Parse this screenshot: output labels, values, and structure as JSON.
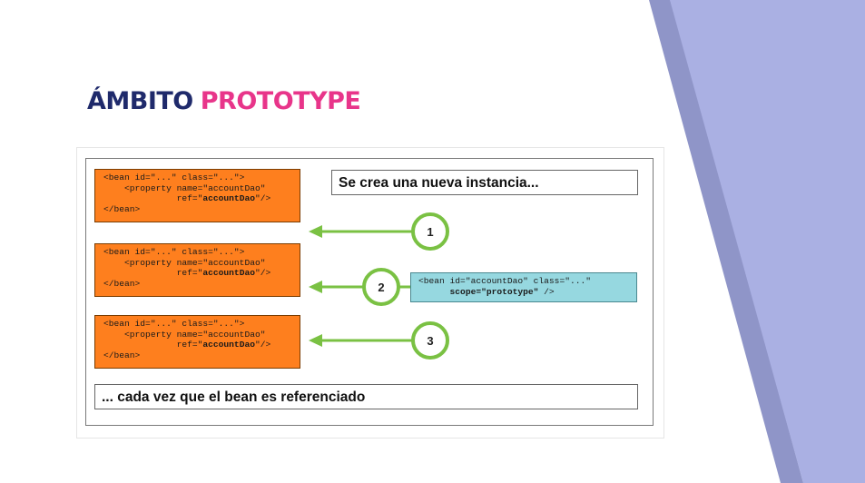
{
  "colors": {
    "title_primary": "#1f2a6b",
    "title_accent": "#e8358a",
    "bean_fill": "#fe7f1e",
    "prototype_fill": "#96d8e0",
    "arrow": "#7ac143",
    "side_band": "#aab0e3"
  },
  "title": {
    "word1": "ÁMBITO",
    "word2": "PROTOTYPE"
  },
  "diagram": {
    "top_caption": "Se crea una nueva instancia...",
    "bottom_caption": "... cada vez que el bean es referenciado",
    "bean_lines": [
      "<bean id=\"...\" class=\"...\">",
      "    <property name=\"accountDao\"",
      "              ref=\"accountDao\"/>",
      "</bean>"
    ],
    "bean_blocks": [
      {
        "line1": "<bean id=\"...\" class=\"...\">",
        "line2": "    <property name=\"accountDao\"",
        "line3_prefix": "              ref=\"",
        "line3_bold": "accountDao",
        "line3_suffix": "\"/>",
        "line4": "</bean>"
      },
      {
        "line1": "<bean id=\"...\" class=\"...\">",
        "line2": "    <property name=\"accountDao\"",
        "line3_prefix": "              ref=\"",
        "line3_bold": "accountDao",
        "line3_suffix": "\"/>",
        "line4": "</bean>"
      },
      {
        "line1": "<bean id=\"...\" class=\"...\">",
        "line2": "    <property name=\"accountDao\"",
        "line3_prefix": "              ref=\"",
        "line3_bold": "accountDao",
        "line3_suffix": "\"/>",
        "line4": "</bean>"
      }
    ],
    "steps": [
      "1",
      "2",
      "3"
    ],
    "prototype_def": {
      "line1": "<bean id=\"accountDao\" class=\"...\"",
      "line2_prefix": "      ",
      "line2_bold": "scope=\"prototype\"",
      "line2_suffix": " />"
    }
  }
}
